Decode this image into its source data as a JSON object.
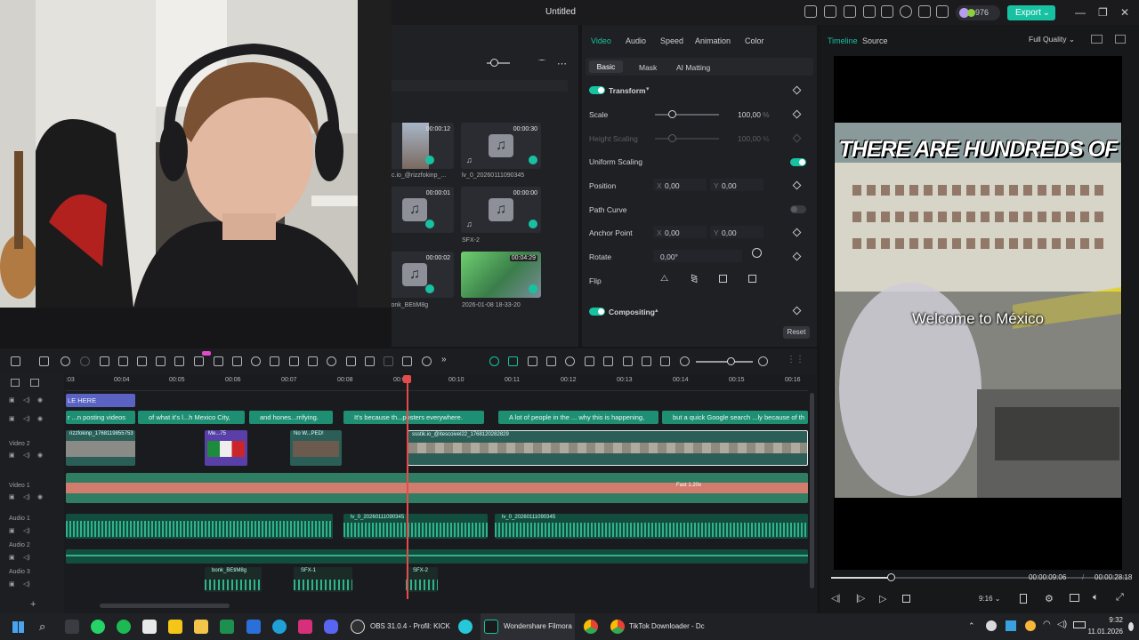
{
  "app": {
    "title": "Untitled",
    "credits": "976",
    "export_label": "Export"
  },
  "media": {
    "items": [
      {
        "duration": "00:00:12",
        "caption": "c.io_@rizzfokinp_..."
      },
      {
        "duration": "00:00:30",
        "caption": "lv_0_20260111090345"
      },
      {
        "duration": "00:00:01",
        "caption": ""
      },
      {
        "duration": "00:00:00",
        "caption": "SFX-2"
      },
      {
        "duration": "00:00:02",
        "caption": "conk_BEtiM8g"
      },
      {
        "duration": "00:04:29",
        "caption": "2026-01-08 18-33-20"
      }
    ]
  },
  "props": {
    "tabs": [
      "Video",
      "Audio",
      "Speed",
      "Animation",
      "Color"
    ],
    "subtabs": [
      "Basic",
      "Mask",
      "AI Matting"
    ],
    "transform_label": "Transform",
    "scale_label": "Scale",
    "scale_value": "100,00",
    "height_scaling_label": "Height Scaling",
    "height_scaling_value": "100,00",
    "uniform_scaling_label": "Uniform Scaling",
    "position_label": "Position",
    "pos_x": "0,00",
    "pos_y": "0,00",
    "path_curve_label": "Path Curve",
    "anchor_label": "Anchor Point",
    "anchor_x": "0,00",
    "anchor_y": "0,00",
    "rotate_label": "Rotate",
    "rotate_value": "0,00°",
    "flip_label": "Flip",
    "compositing_label": "Compositing",
    "reset_label": "Reset",
    "x_label": "X",
    "y_label": "Y",
    "pct": "%"
  },
  "player": {
    "tabs": [
      "Timeline",
      "Source"
    ],
    "quality": "Full Quality",
    "caption_top": "THERE ARE HUNDREDS OF",
    "caption_mid": "Welcome to México",
    "current_time": "00:00:09:06",
    "total_time": "00:00:28:18",
    "separator": "/",
    "aspect": "9:16",
    "progress": 0.2
  },
  "timeline": {
    "ruler": [
      "00:04",
      "00:05",
      "00:06",
      "00:07",
      "00:08",
      "00:09",
      "00:10",
      "00:11",
      "00:12",
      "00:13",
      "00:14",
      "00:15",
      "00:16"
    ],
    "ruler_left": ":03",
    "tracks": [
      "Video 2",
      "Video 1",
      "Audio 1",
      "Audio 2",
      "Audio 3"
    ],
    "text_clips": [
      "LE HERE",
      "r ...n posting videos",
      "of what it's l...h Mexico City,",
      "and hones...rrifying.",
      "It's because th...posters everywhere.",
      "A lot of people in the ... why this is happening,",
      "but a quick Google search ...ly because of th"
    ],
    "video2_clips": [
      "rizzfokinp_1768119855753",
      "Me...75",
      "No W...PED!",
      "ssstik.io_@itescoivel22_1768120282829"
    ],
    "video1_speed": "Fast 1.20x",
    "audio1_clips": [
      "lv_0_20260111090345",
      "lv_0_20260111090345"
    ],
    "audio3_clips": [
      "bonk_BEtiM8g",
      "SFX-1",
      "SFX-2"
    ]
  },
  "taskbar": {
    "apps": [
      "OBS 31.0.4 - Profil: KICK",
      "Wondershare Filmora",
      "TikTok Downloader - Dc"
    ],
    "time": "9:32",
    "date": "11.01.2026"
  }
}
